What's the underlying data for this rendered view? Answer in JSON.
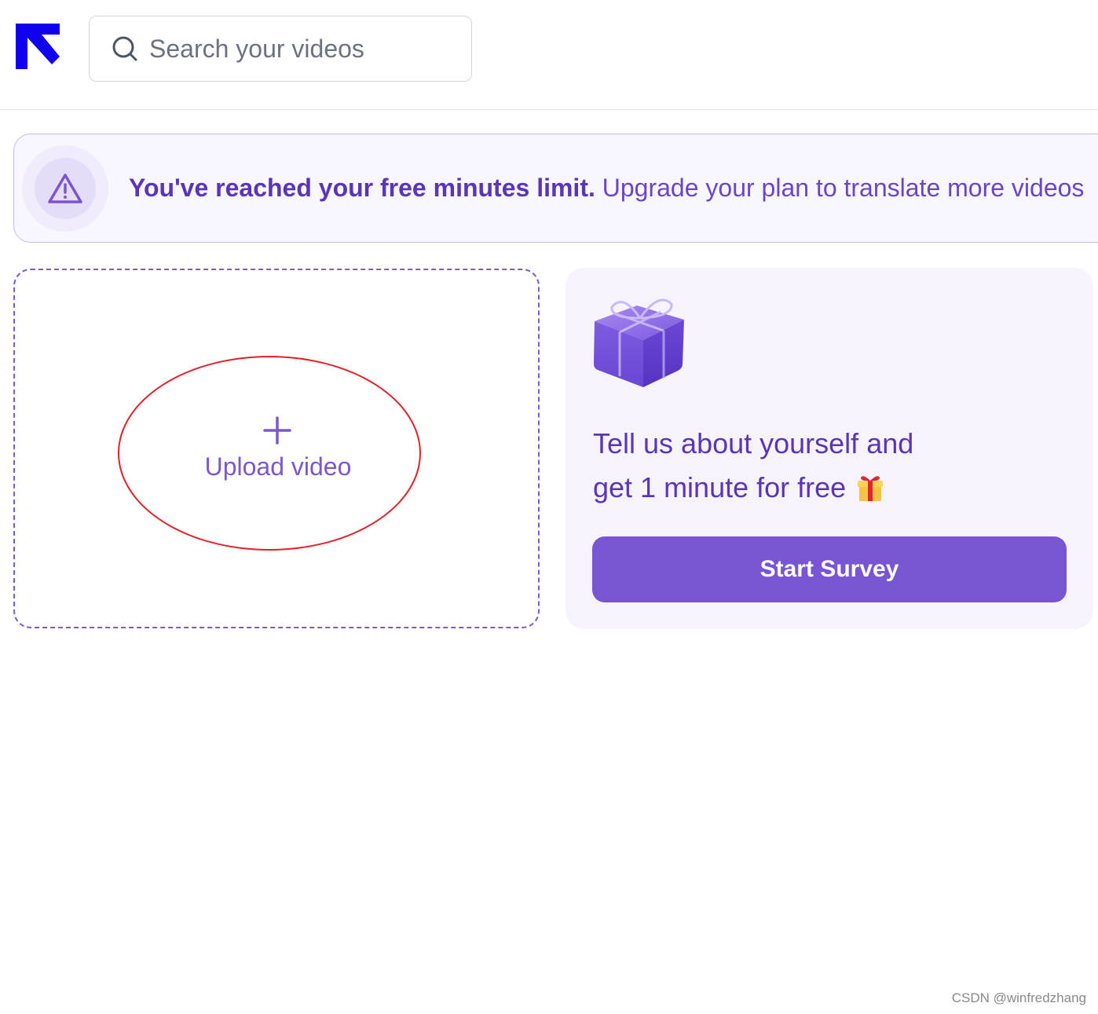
{
  "header": {
    "logo_icon": "arrow-up-left-logo-icon",
    "search": {
      "placeholder": "Search your videos",
      "value": "",
      "icon": "search-icon"
    }
  },
  "banner": {
    "icon": "warning-triangle-icon",
    "strong_text": "You've reached your free minutes limit.",
    "normal_text": "Upgrade your plan to translate more videos"
  },
  "upload_card": {
    "icon": "plus-icon",
    "label": "Upload video"
  },
  "promo_card": {
    "image": "gift-box-illustration",
    "line1": "Tell us about yourself and",
    "line2": "get 1 minute for free",
    "emoji": "gift-emoji-icon",
    "button_label": "Start Survey"
  },
  "watermark": "CSDN @winfredzhang",
  "colors": {
    "accent": "#7856d3",
    "accent_text": "#5a35b8",
    "logo_blue": "#1000ee",
    "highlight": "#e0212b",
    "banner_bg": "#f8f6fe",
    "promo_bg": "#f6f3fd"
  }
}
